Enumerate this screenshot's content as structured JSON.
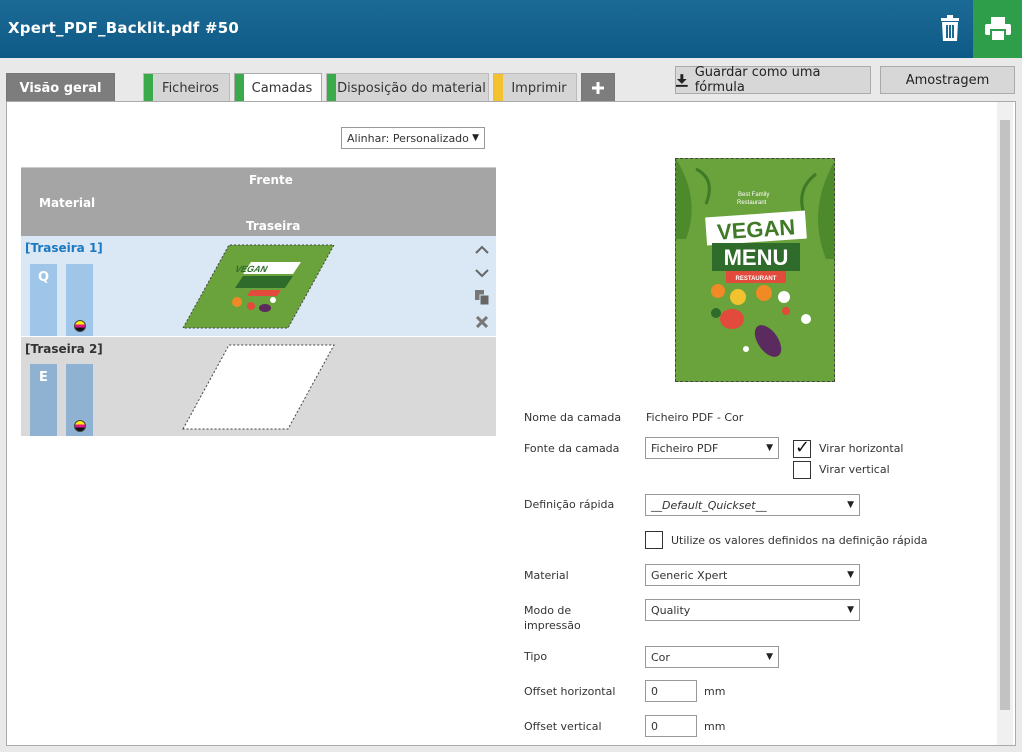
{
  "header": {
    "title": "Xpert_PDF_Backlit.pdf #50"
  },
  "tabs": [
    {
      "label": "Visão geral"
    },
    {
      "label": "Ficheiros",
      "stripe": "#3aaa4a"
    },
    {
      "label": "Camadas",
      "stripe": "#3aaa4a"
    },
    {
      "label": "Disposição do material",
      "stripe": "#3aaa4a"
    },
    {
      "label": "Imprimir",
      "stripe": "#f2c230"
    },
    {
      "label": "+"
    }
  ],
  "actions": {
    "save_recipe": "Guardar como uma fórmula",
    "sample": "Amostragem"
  },
  "align": {
    "value": "Alinhar: Personalizado"
  },
  "layers_table": {
    "col_front": "Frente",
    "col_material": "Material",
    "col_back": "Traseira",
    "rows": [
      {
        "name": "[Traseira 1]",
        "mode_letter": "Q",
        "selected": true
      },
      {
        "name": "[Traseira 2]",
        "mode_letter": "E",
        "selected": false
      }
    ]
  },
  "preview": {
    "tagline": "Best Family\nRestaurant",
    "word1": "VEGAN",
    "word2": "MENU",
    "badge": "RESTAURANT"
  },
  "form": {
    "layer_name_label": "Nome da camada",
    "layer_name_value": "Ficheiro PDF - Cor",
    "layer_source_label": "Fonte da camada",
    "layer_source_value": "Ficheiro PDF",
    "flip_horizontal_label": "Virar horizontal",
    "flip_horizontal_checked": true,
    "flip_vertical_label": "Virar vertical",
    "flip_vertical_checked": false,
    "quickset_label": "Definição rápida",
    "quickset_value": "__Default_Quickset__",
    "use_quickset_label": "Utilize os valores definidos na definição rápida",
    "use_quickset_checked": false,
    "material_label": "Material",
    "material_value": "Generic Xpert",
    "print_mode_label_1": "Modo de",
    "print_mode_label_2": "impressão",
    "print_mode_value": "Quality",
    "type_label": "Tipo",
    "type_value": "Cor",
    "offset_h_label": "Offset horizontal",
    "offset_h_value": "0",
    "offset_h_unit": "mm",
    "offset_v_label": "Offset vertical",
    "offset_v_value": "0",
    "offset_v_unit": "mm"
  },
  "colors": {
    "header_bg": "#0e5a86",
    "print_green": "#2e9e4a",
    "tab_stripe_green": "#3aaa4a",
    "tab_stripe_yellow": "#f2c230",
    "selected_row": "#d9e8f4",
    "layer_link": "#1c78c0"
  }
}
